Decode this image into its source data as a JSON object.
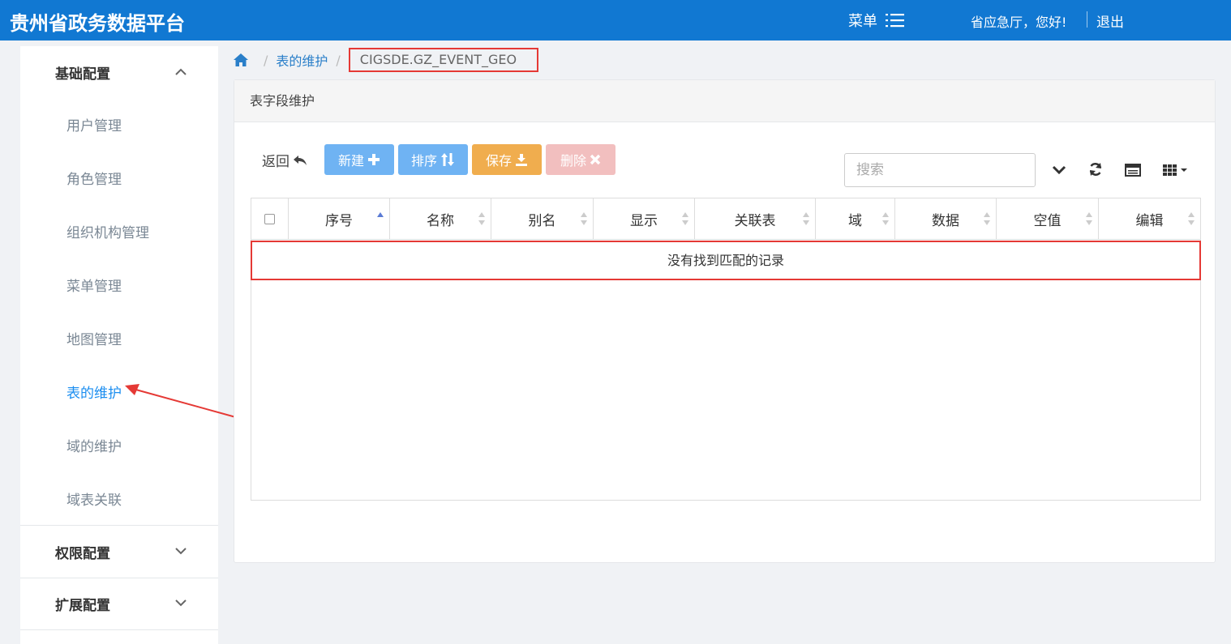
{
  "header": {
    "app_title": "贵州省政务数据平台",
    "menu_label": "菜单",
    "greeting": "省应急厅，您好!",
    "logout_label": "退出"
  },
  "sidebar": {
    "groups": [
      {
        "title": "基础配置",
        "expanded": true,
        "items": [
          {
            "label": "用户管理"
          },
          {
            "label": "角色管理"
          },
          {
            "label": "组织机构管理"
          },
          {
            "label": "菜单管理"
          },
          {
            "label": "地图管理"
          },
          {
            "label": "表的维护",
            "active": true
          },
          {
            "label": "域的维护"
          },
          {
            "label": "域表关联"
          }
        ]
      },
      {
        "title": "权限配置",
        "expanded": false
      },
      {
        "title": "扩展配置",
        "expanded": false
      }
    ]
  },
  "breadcrumb": {
    "parent": "表的维护",
    "current": "CIGSDE.GZ_EVENT_GEO"
  },
  "panel": {
    "title": "表字段维护",
    "back_label": "返回",
    "buttons": {
      "new": "新建",
      "sort": "排序",
      "save": "保存",
      "delete": "删除"
    },
    "search_placeholder": "搜索",
    "table": {
      "columns": [
        "序号",
        "名称",
        "别名",
        "显示",
        "关联表",
        "域",
        "数据",
        "空值",
        "编辑"
      ],
      "empty_message": "没有找到匹配的记录"
    }
  },
  "colors": {
    "header_bg": "#1178d2",
    "btn_new": "#6fb3f3",
    "btn_sort": "#6fb3f3",
    "btn_save": "#f0ad4e",
    "btn_delete": "#f2bfbf",
    "annotation": "#e53935",
    "active_link": "#1a8df0"
  }
}
